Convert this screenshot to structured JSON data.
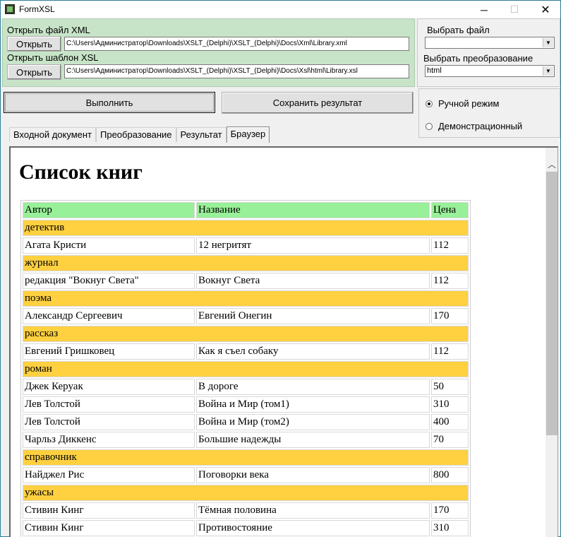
{
  "window": {
    "title": "FormXSL",
    "minimize_glyph": "─",
    "maximize_glyph": "☐",
    "close_glyph": "✕",
    "icon": "app-icon"
  },
  "xml_section": {
    "label": "Открыть файл XML",
    "button": "Открыть",
    "path": "C:\\Users\\Администратор\\Downloads\\XSLT_(Delphi)\\XSLT_(Delphi)\\Docs\\Xml\\Library.xml"
  },
  "xsl_section": {
    "label": "Открыть шаблон XSL",
    "button": "Открыть",
    "path": "C:\\Users\\Администратор\\Downloads\\XSLT_(Delphi)\\XSLT_(Delphi)\\Docs\\Xsl\\html\\Library.xsl"
  },
  "right_panel": {
    "choose_file_label": "Выбрать файл",
    "choose_file_value": "",
    "choose_transform_label": "Выбрать преобразование",
    "choose_transform_value": "html"
  },
  "actions": {
    "run": "Выполнить",
    "save": "Сохранить результат"
  },
  "mode": {
    "manual": "Ручной режим",
    "demo": "Демонстрационный",
    "selected": "manual"
  },
  "tabs": [
    "Входной документ",
    "Преобразование",
    "Результат",
    "Браузер"
  ],
  "active_tab": "Браузер",
  "document": {
    "heading": "Список книг",
    "columns": [
      "Автор",
      "Название",
      "Цена"
    ],
    "rows": [
      {
        "type": "genre",
        "text": "детектив"
      },
      {
        "type": "book",
        "author": "Агата Кристи",
        "title": "12 негритят",
        "price": "112"
      },
      {
        "type": "genre",
        "text": "журнал"
      },
      {
        "type": "book",
        "author": "редакция \"Вокнуг Света\"",
        "title": "Вокнуг Света",
        "price": "112"
      },
      {
        "type": "genre",
        "text": "поэма"
      },
      {
        "type": "book",
        "author": "Александр Сергеевич",
        "title": "Евгений Онегин",
        "price": "170"
      },
      {
        "type": "genre",
        "text": "рассказ"
      },
      {
        "type": "book",
        "author": "Евгений Гришковец",
        "title": "Как я съел собаку",
        "price": "112"
      },
      {
        "type": "genre",
        "text": "роман"
      },
      {
        "type": "book",
        "author": "Джек Керуак",
        "title": "В дороге",
        "price": "50"
      },
      {
        "type": "book",
        "author": "Лев Толстой",
        "title": "Война и Мир (том1)",
        "price": "310"
      },
      {
        "type": "book",
        "author": "Лев Толстой",
        "title": "Война и Мир (том2)",
        "price": "400"
      },
      {
        "type": "book",
        "author": "Чарльз Диккенс",
        "title": "Большие надежды",
        "price": "70"
      },
      {
        "type": "genre",
        "text": "справочник"
      },
      {
        "type": "book",
        "author": "Найджел Рис",
        "title": "Поговорки века",
        "price": "800"
      },
      {
        "type": "genre",
        "text": "ужасы"
      },
      {
        "type": "book",
        "author": "Стивин Кинг",
        "title": "Тёмная половина",
        "price": "170"
      },
      {
        "type": "book",
        "author": "Стивин Кинг",
        "title": "Противостояние",
        "price": "310"
      }
    ]
  },
  "colors": {
    "panel_green": "#c8e4c8",
    "header_row": "#98f098",
    "genre_row": "#ffd040"
  }
}
